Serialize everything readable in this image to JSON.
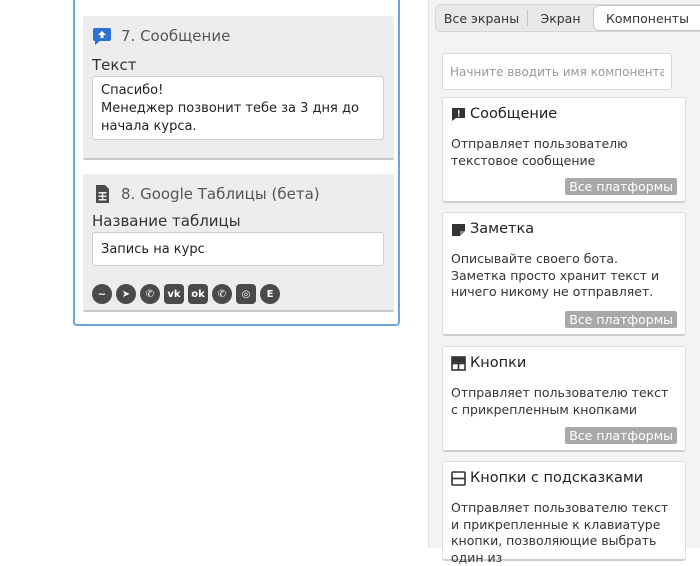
{
  "blocks": {
    "message": {
      "title": "7. Сообщение",
      "field_label": "Текст",
      "text_lines": [
        "Спасибо!",
        "Менеджер позвонит тебе за 3 дня до",
        "начала курса."
      ],
      "icon": "chat-upload-icon",
      "icon_color": "#2b73d6"
    },
    "sheets": {
      "title": "8. Google Таблицы (бета)",
      "field_label": "Название таблицы",
      "field_value": "Запись на курс",
      "icon": "spreadsheet-icon",
      "platforms": [
        {
          "name": "messenger-icon",
          "glyph": "~"
        },
        {
          "name": "telegram-icon",
          "glyph": "➤"
        },
        {
          "name": "viber-icon",
          "glyph": "✆"
        },
        {
          "name": "vk-icon",
          "glyph": "vk"
        },
        {
          "name": "odnoklassniki-icon",
          "glyph": "ok"
        },
        {
          "name": "whatsapp-icon",
          "glyph": "✆"
        },
        {
          "name": "instagram-icon",
          "glyph": "◎"
        },
        {
          "name": "yandex-icon",
          "glyph": "E"
        }
      ]
    }
  },
  "panel": {
    "tabs": [
      "Все экраны",
      "Экран",
      "Компоненты"
    ],
    "active_tab": "Компоненты",
    "search_placeholder": "Начните вводить имя компонента...",
    "components": [
      {
        "title": "Сообщение",
        "icon": "message-icon",
        "description": "Отправляет пользователю текстовое сообщение",
        "badge": "Все платформы"
      },
      {
        "title": "Заметка",
        "icon": "note-icon",
        "description": "Описывайте своего бота. Заметка просто хранит текст и ничего никому не отправляет.",
        "badge": "Все платформы"
      },
      {
        "title": "Кнопки",
        "icon": "buttons-grid-icon",
        "description": "Отправляет пользователю текст с прикрепленным кнопками",
        "badge": "Все платформы"
      },
      {
        "title": "Кнопки с подсказками",
        "icon": "keyboard-buttons-icon",
        "description": "Отправляет пользователю текст и прикрепленные к клавиатуре кнопки, позволяющие выбрать один из",
        "badge": ""
      }
    ]
  },
  "colors": {
    "accent": "#6fa3dc",
    "badge": "#a9a9a9"
  }
}
